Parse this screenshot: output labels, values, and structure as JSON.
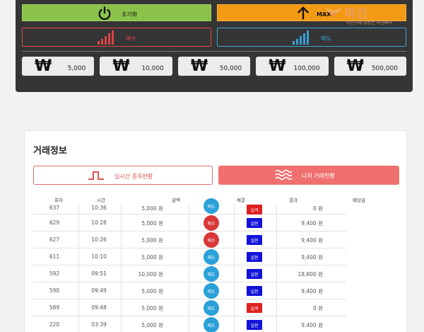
{
  "controls": {
    "reset_label": "초기화",
    "max_label": "MAX",
    "buy_label": "매수",
    "sell_label": "매도"
  },
  "amounts": [
    {
      "symbol": "₩",
      "value": "5,000"
    },
    {
      "symbol": "₩",
      "value": "10,000"
    },
    {
      "symbol": "₩",
      "value": "50,000"
    },
    {
      "symbol": "₩",
      "value": "100,000"
    },
    {
      "symbol": "₩",
      "value": "500,000"
    }
  ],
  "logo": {
    "title": "마진",
    "subtitle": "마진거래 검증은 마진페어"
  },
  "info": {
    "title": "거래정보",
    "tab_realtime": "실시간 종목현황",
    "tab_mine": "나의 거래현황"
  },
  "table": {
    "headers": [
      "회차",
      "시간",
      "금액",
      "체결",
      "결과",
      "배당금"
    ],
    "rows": [
      {
        "no": "637",
        "time": "10:36",
        "amount": "5,000 원",
        "side": "매도",
        "status": "실격",
        "result": "0 원"
      },
      {
        "no": "629",
        "time": "10:28",
        "amount": "5,000 원",
        "side": "매수",
        "status": "실현",
        "result": "9,400 원"
      },
      {
        "no": "627",
        "time": "10:26",
        "amount": "5,000 원",
        "side": "매수",
        "status": "실현",
        "result": "9,400 원"
      },
      {
        "no": "611",
        "time": "10:10",
        "amount": "5,000 원",
        "side": "매도",
        "status": "실현",
        "result": "9,400 원"
      },
      {
        "no": "592",
        "time": "09:51",
        "amount": "10,000 원",
        "side": "매도",
        "status": "실현",
        "result": "18,800 원"
      },
      {
        "no": "590",
        "time": "09:49",
        "amount": "5,000 원",
        "side": "매도",
        "status": "실현",
        "result": "9,400 원"
      },
      {
        "no": "589",
        "time": "09:48",
        "amount": "5,000 원",
        "side": "매도",
        "status": "실격",
        "result": "0 원"
      },
      {
        "no": "220",
        "time": "03:39",
        "amount": "5,000 원",
        "side": "매도",
        "status": "실현",
        "result": "9,400 원"
      }
    ]
  },
  "colors": {
    "reset": "#8bc34a",
    "max": "#f39a14",
    "buy": "#d83838",
    "sell": "#2aa1d8",
    "fail": "#e02020",
    "ok": "#1212d8",
    "tab_active": "#f07070"
  }
}
